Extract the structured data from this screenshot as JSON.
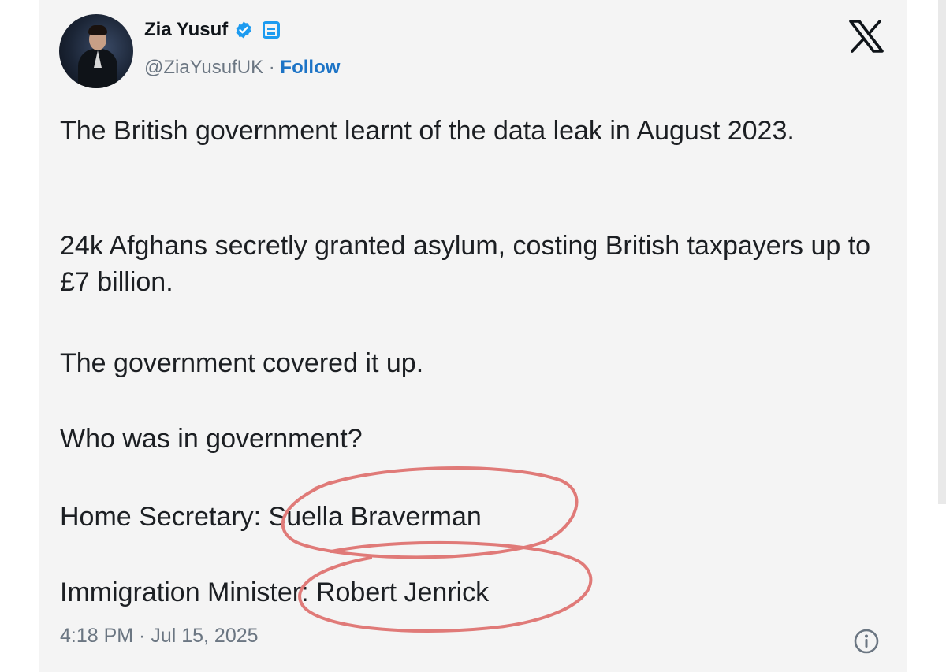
{
  "post": {
    "author_name": "Zia Yusuf",
    "handle": "@ZiaYusufUK",
    "separator": " · ",
    "follow_label": "Follow",
    "paragraphs": [
      "The British government learnt of the data leak in August 2023.",
      "24k Afghans secretly granted asylum, costing British taxpayers up to £7 billion.",
      "The government covered it up.",
      "Who was in government?",
      "Home Secretary: Suella Braverman",
      "Immigration Minister: Robert Jenrick"
    ],
    "timestamp": "4:18 PM · Jul 15, 2025"
  },
  "icons": {
    "verified": "verified-badge-icon",
    "affiliation": "affiliation-badge-icon",
    "brand": "x-logo-icon",
    "info": "info-icon"
  },
  "colors": {
    "accent": "#1d9bf0",
    "follow": "#1d74c6",
    "annotation": "#e07a78",
    "secondary_text": "#6b7682",
    "card_bg": "#f4f4f4"
  }
}
